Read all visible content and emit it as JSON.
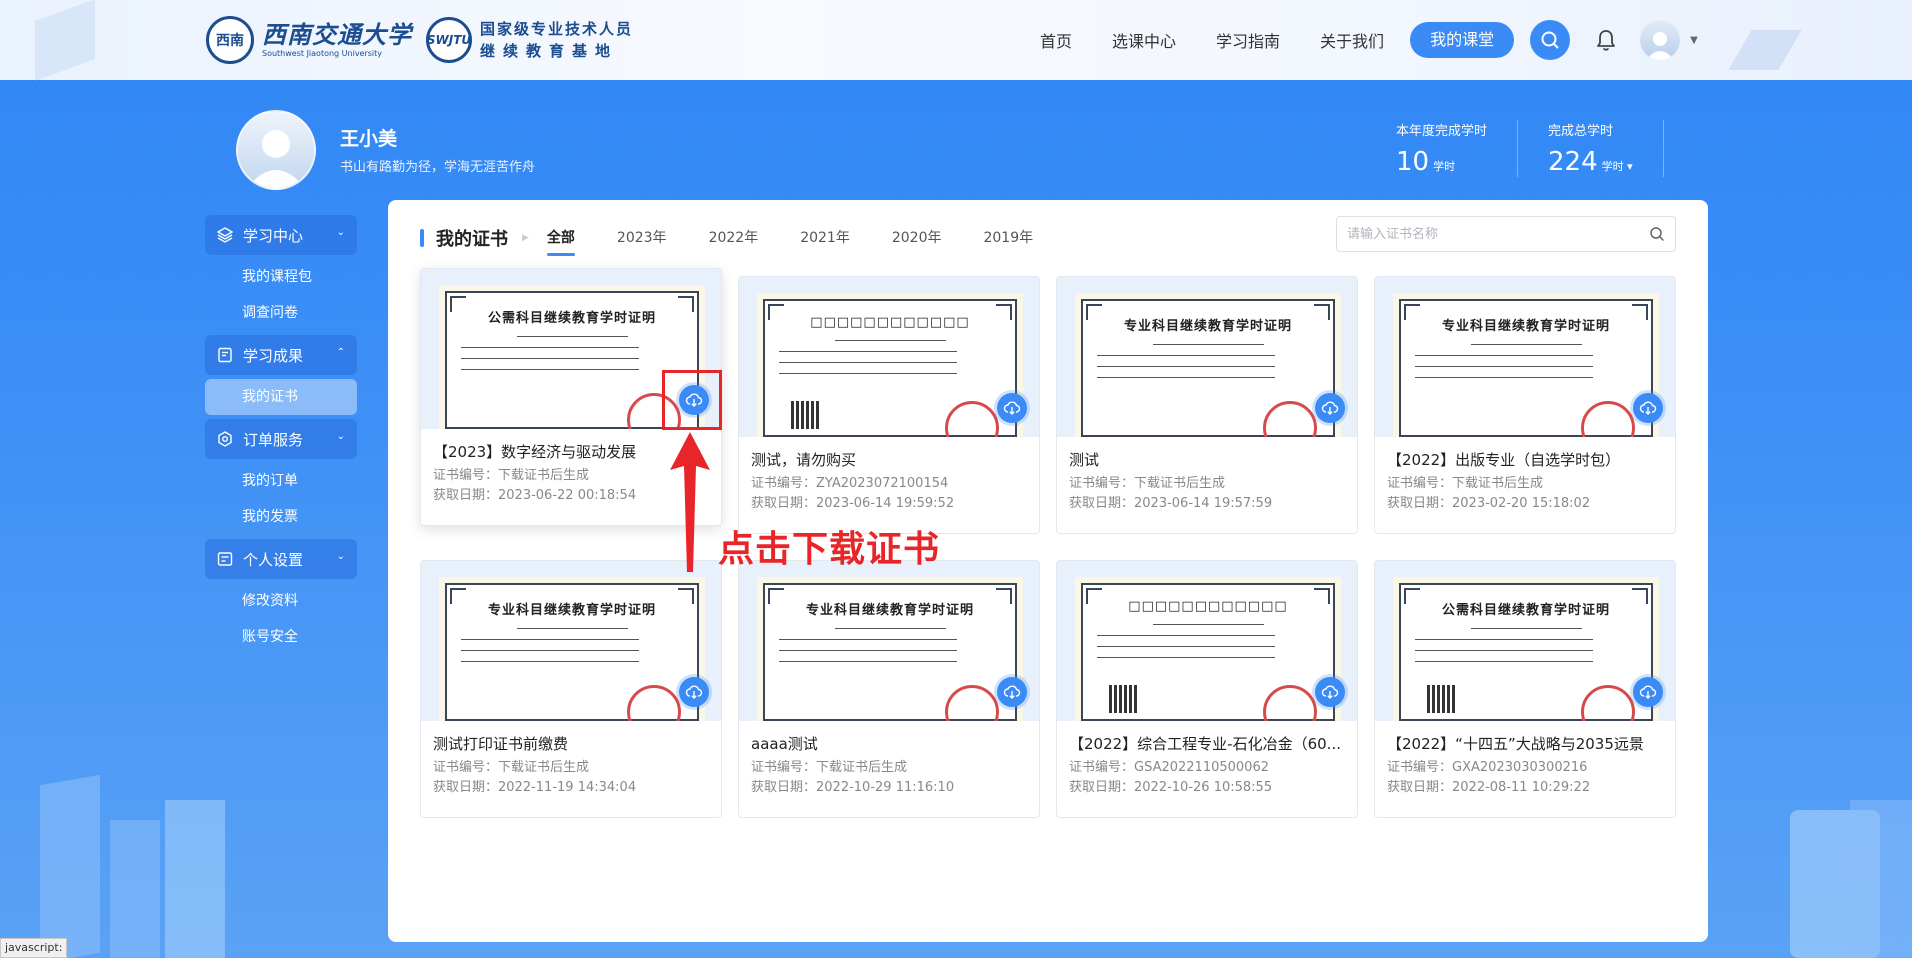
{
  "header": {
    "logo1_seal": "西南",
    "logo1_cn": "西南交通大学",
    "logo1_en": "Southwest Jiaotong University",
    "logo2_seal": "SWJTU",
    "logo2_line1": "国家级专业技术人员",
    "logo2_line2": "继续教育基地",
    "nav": [
      "首页",
      "选课中心",
      "学习指南",
      "关于我们"
    ],
    "my_course": "我的课堂"
  },
  "profile": {
    "name": "王小美",
    "motto": "书山有路勤为径，学海无涯苦作舟",
    "stats": [
      {
        "label": "本年度完成学时",
        "value": "10",
        "unit": "学时"
      },
      {
        "label": "完成总学时",
        "value": "224",
        "unit": "学时 ▾"
      }
    ]
  },
  "sidebar": {
    "groups": [
      {
        "label": "学习中心",
        "icon": "layers-icon",
        "chev": "⌄",
        "items": [
          "我的课程包",
          "调查问卷"
        ]
      },
      {
        "label": "学习成果",
        "icon": "certificate-icon",
        "chev": "⌃",
        "items": [
          "我的证书"
        ]
      },
      {
        "label": "订单服务",
        "icon": "settings-icon",
        "chev": "⌄",
        "items": [
          "我的订单",
          "我的发票"
        ]
      },
      {
        "label": "个人设置",
        "icon": "profile-icon",
        "chev": "⌄",
        "items": [
          "修改资料",
          "账号安全"
        ]
      }
    ],
    "active_item": "我的证书"
  },
  "main": {
    "title": "我的证书",
    "tabs": [
      "全部",
      "2023年",
      "2022年",
      "2021年",
      "2020年",
      "2019年"
    ],
    "active_tab": "全部",
    "search_placeholder": "请输入证书名称",
    "cert_no_label": "证书编号：",
    "date_label": "获取日期：",
    "cards": [
      {
        "name": "【2023】数字经济与驱动发展",
        "no": "下载证书后生成",
        "date": "2023-06-22 00:18:54",
        "cert_title": "公需科目继续教育学时证明",
        "qr": false
      },
      {
        "name": "测试，请勿购买",
        "no": "ZYA2023072100154",
        "date": "2023-06-14 19:59:52",
        "cert_title": "□□□□□□□□□□□□",
        "qr": true
      },
      {
        "name": "测试",
        "no": "下载证书后生成",
        "date": "2023-06-14 19:57:59",
        "cert_title": "专业科目继续教育学时证明",
        "qr": false
      },
      {
        "name": "【2022】出版专业（自选学时包）",
        "no": "下载证书后生成",
        "date": "2023-02-20 15:18:02",
        "cert_title": "专业科目继续教育学时证明",
        "qr": false
      },
      {
        "name": "测试打印证书前缴费",
        "no": "下载证书后生成",
        "date": "2022-11-19 14:34:04",
        "cert_title": "专业科目继续教育学时证明",
        "qr": false
      },
      {
        "name": "aaaa测试",
        "no": "下载证书后生成",
        "date": "2022-10-29 11:16:10",
        "cert_title": "专业科目继续教育学时证明",
        "qr": false
      },
      {
        "name": "【2022】综合工程专业-石化冶金（60...",
        "no": "GSA2022110500062",
        "date": "2022-10-26 10:58:55",
        "cert_title": "□□□□□□□□□□□□",
        "qr": true
      },
      {
        "name": "【2022】“十四五”大战略与2035远景",
        "no": "GXA2023030300216",
        "date": "2022-08-11 10:29:22",
        "cert_title": "公需科目继续教育学时证明",
        "qr": true
      }
    ]
  },
  "annotation": {
    "text": "点击下载证书",
    "color": "#e8262a"
  },
  "status_bar": "javascript:",
  "colors": {
    "accent": "#3a8bf5",
    "bg": "#2f86f5"
  }
}
